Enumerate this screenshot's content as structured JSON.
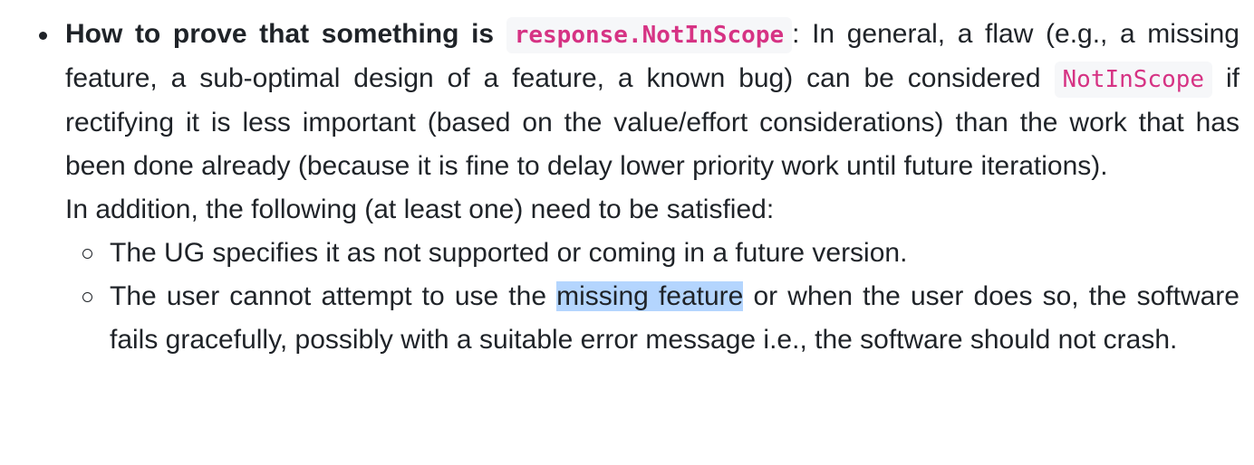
{
  "bullet": {
    "lead": "How to prove that something is",
    "lead_code": "response.NotInScope",
    "text_1": ": In general, a flaw (e.g., a missing feature, a sub-optimal design of a feature, a known bug) can be considered",
    "inline_code": "NotInScope",
    "text_2": "if rectifying it is less important (based on the value/effort considerations) than the work that has been done already (because it is fine to delay lower priority work until future iterations).",
    "addition": "In addition, the following (at least one) need to be satisfied:",
    "sub_items": [
      {
        "text": "The UG specifies it as not supported or coming in a future version."
      },
      {
        "before": "The user cannot attempt to use the",
        "highlight": "missing feature",
        "after": "or when the user does so, the software fails gracefully, possibly with a suitable error message i.e., the software should not crash."
      }
    ]
  },
  "colors": {
    "text": "#1f2328",
    "code_text": "#d63384",
    "code_bg": "#f6f7f9",
    "selection": "#b4d5fe"
  }
}
